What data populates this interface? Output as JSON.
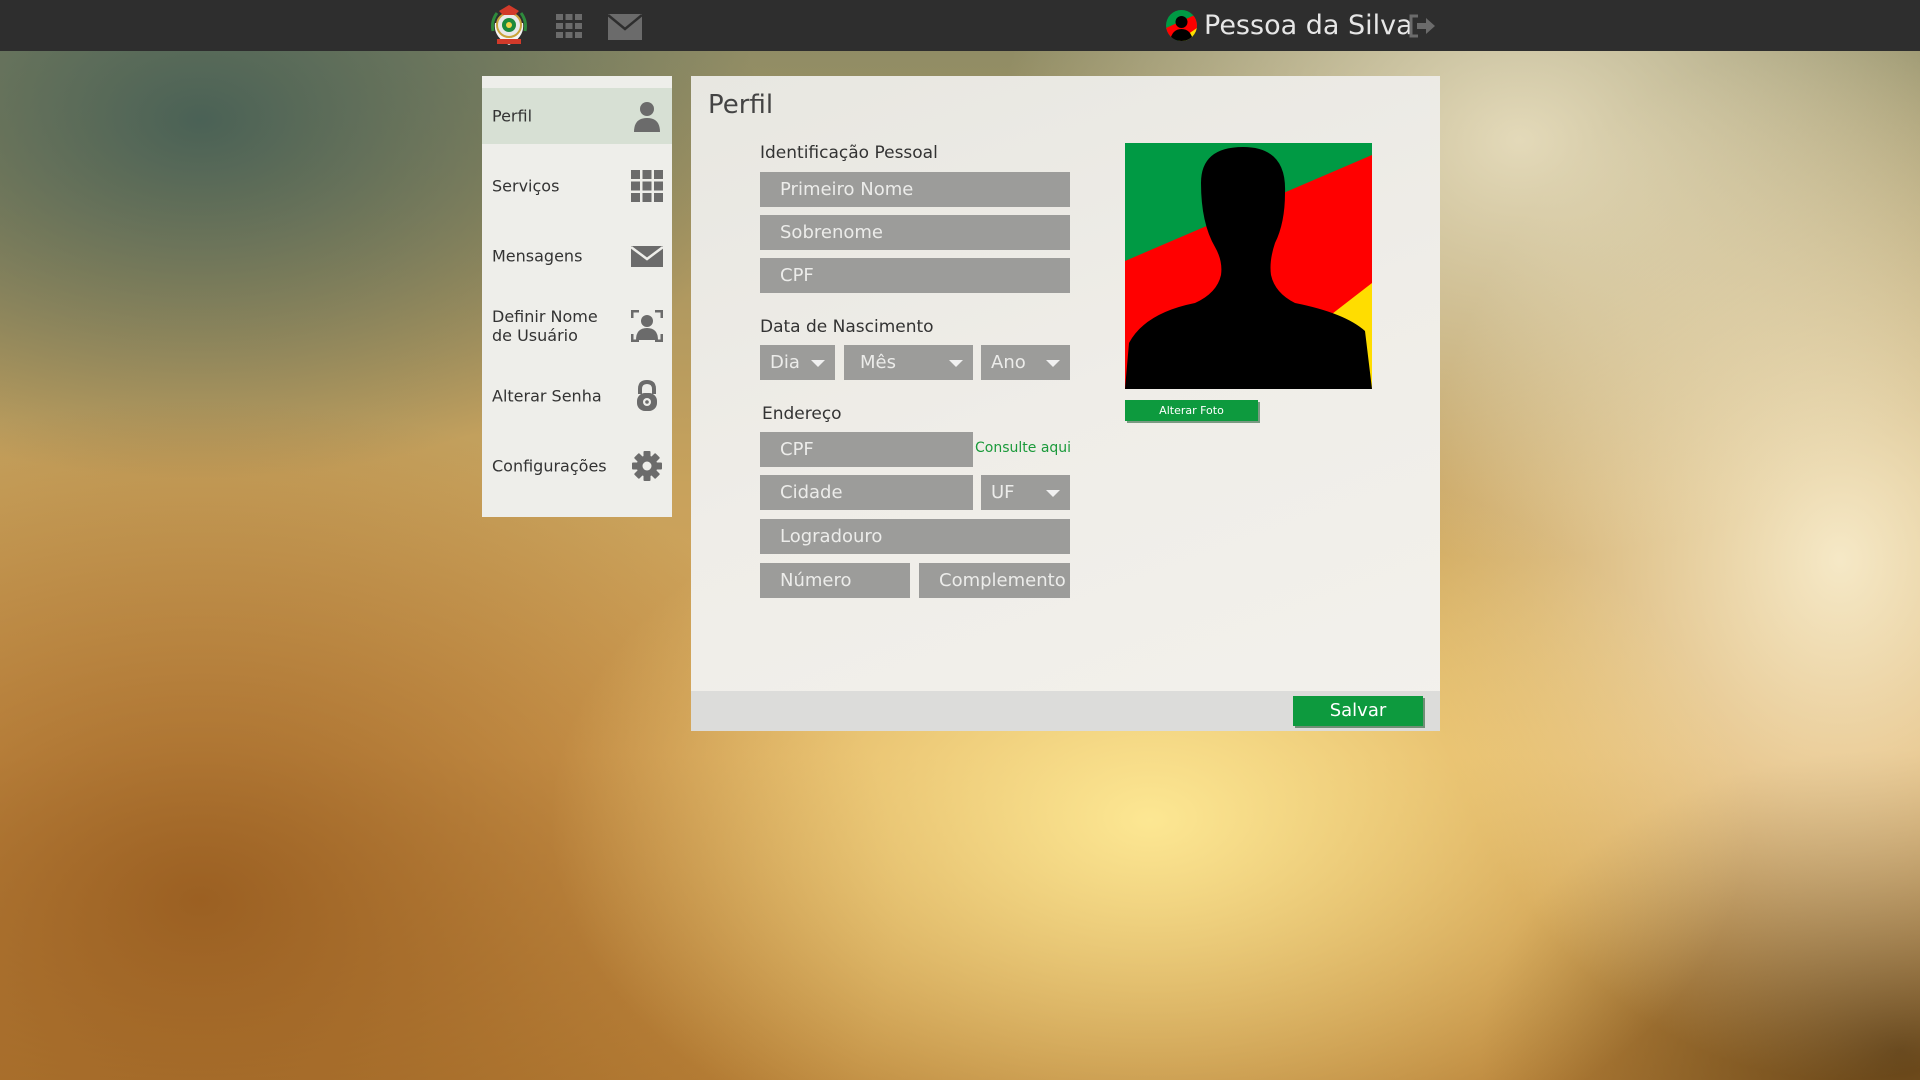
{
  "topbar": {
    "user_name": "Pessoa da Silva",
    "icons": [
      "state-crest-logo",
      "apps-grid-icon",
      "mail-icon",
      "state-flag-avatar-icon",
      "logout-icon"
    ]
  },
  "sidebar": {
    "items": [
      {
        "label": "Perfil",
        "icon": "user-icon",
        "active": true
      },
      {
        "label": "Serviços",
        "icon": "apps-grid-icon",
        "active": false
      },
      {
        "label": "Mensagens",
        "icon": "mail-icon",
        "active": false
      },
      {
        "label": "Definir Nome de Usuário",
        "icon": "user-id-icon",
        "active": false
      },
      {
        "label": "Alterar Senha",
        "icon": "lock-icon",
        "active": false
      },
      {
        "label": "Configurações",
        "icon": "gear-icon",
        "active": false
      }
    ]
  },
  "main": {
    "title": "Perfil",
    "identificacao": {
      "label": "Identificação Pessoal",
      "first_name_placeholder": "Primeiro Nome",
      "last_name_placeholder": "Sobrenome",
      "cpf_placeholder": "CPF"
    },
    "nascimento": {
      "label": "Data de Nascimento",
      "day": "Dia",
      "month": "Mês",
      "year": "Ano"
    },
    "endereco": {
      "label": "Endereço",
      "cep_placeholder": "CPF",
      "consulte_link": "Consulte aqui",
      "city_placeholder": "Cidade",
      "uf": "UF",
      "street_placeholder": "Logradouro",
      "number_placeholder": "Número",
      "complement_placeholder": "Complemento"
    },
    "photo": {
      "change_label": "Alterar Foto"
    },
    "save_label": "Salvar"
  },
  "colors": {
    "topbar": "#2e2e2e",
    "accent_green": "#0d9a3e",
    "field_gray": "#9c9c9a",
    "flag_green": "#009a44",
    "flag_red": "#ff0000",
    "flag_yellow": "#ffdd00"
  }
}
